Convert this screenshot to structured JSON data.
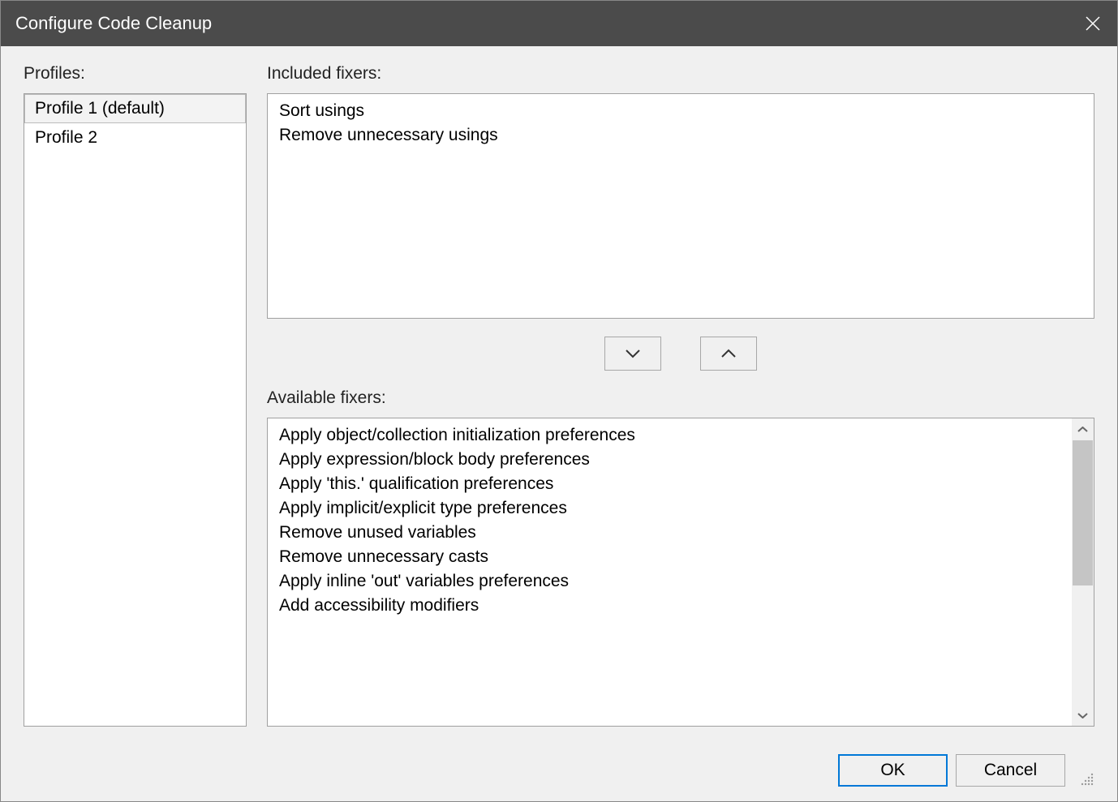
{
  "window": {
    "title": "Configure Code Cleanup"
  },
  "labels": {
    "profiles": "Profiles:",
    "included_fixers": "Included fixers:",
    "available_fixers": "Available fixers:"
  },
  "profiles": [
    {
      "label": "Profile 1 (default)",
      "selected": true
    },
    {
      "label": "Profile 2",
      "selected": false
    }
  ],
  "included_fixers": [
    "Sort usings",
    "Remove unnecessary usings"
  ],
  "available_fixers": [
    "Apply object/collection initialization preferences",
    "Apply expression/block body preferences",
    "Apply 'this.' qualification preferences",
    "Apply implicit/explicit type preferences",
    "Remove unused variables",
    "Remove unnecessary casts",
    "Apply inline 'out' variables preferences",
    "Add accessibility modifiers"
  ],
  "buttons": {
    "ok": "OK",
    "cancel": "Cancel"
  }
}
